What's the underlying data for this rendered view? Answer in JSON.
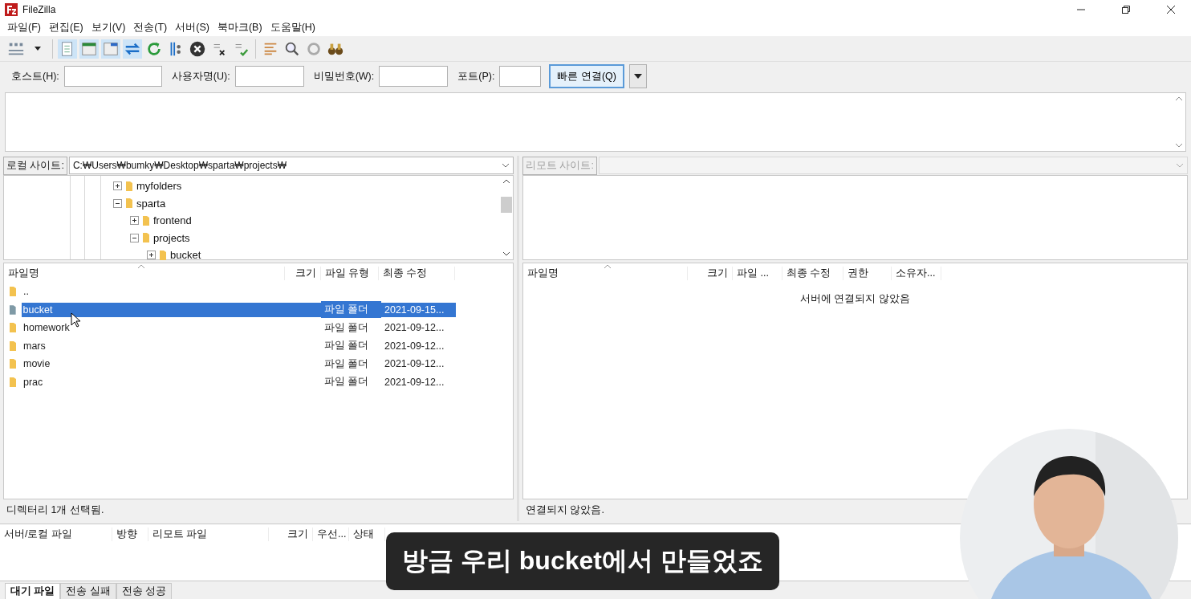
{
  "window": {
    "title": "FileZilla"
  },
  "menu": [
    "파일(F)",
    "편집(E)",
    "보기(V)",
    "전송(T)",
    "서버(S)",
    "북마크(B)",
    "도움말(H)"
  ],
  "quickconnect": {
    "fields": [
      {
        "label": "호스트(H):",
        "kind": "wide"
      },
      {
        "label": "사용자명(U):",
        "kind": "medium"
      },
      {
        "label": "비밀번호(W):",
        "kind": "medium"
      },
      {
        "label": "포트(P):",
        "kind": "narrow"
      }
    ],
    "button": "빠른 연결(Q)"
  },
  "local_site": {
    "label": "로컬 사이트:",
    "path": "C:₩Users₩bumky₩Desktop₩sparta₩projects₩"
  },
  "remote_site": {
    "label": "리모트 사이트:",
    "disabled": true
  },
  "local_tree": [
    {
      "name": "myfolders",
      "expanded": false
    },
    {
      "name": "sparta",
      "expanded": true,
      "children": [
        {
          "name": "frontend",
          "expanded": false
        },
        {
          "name": "projects",
          "expanded": true,
          "children": [
            {
              "name": "bucket",
              "expanded": false
            }
          ]
        }
      ]
    }
  ],
  "local_files": {
    "columns": [
      "파일명",
      "크기",
      "파일 유형",
      "최종 수정"
    ],
    "rows": [
      {
        "name": "..",
        "type": "",
        "modified": "",
        "selected": false
      },
      {
        "name": "bucket",
        "type": "파일 폴더",
        "modified": "2021-09-15...",
        "selected": true
      },
      {
        "name": "homework",
        "type": "파일 폴더",
        "modified": "2021-09-12...",
        "selected": false
      },
      {
        "name": "mars",
        "type": "파일 폴더",
        "modified": "2021-09-12...",
        "selected": false
      },
      {
        "name": "movie",
        "type": "파일 폴더",
        "modified": "2021-09-12...",
        "selected": false
      },
      {
        "name": "prac",
        "type": "파일 폴더",
        "modified": "2021-09-12...",
        "selected": false
      }
    ]
  },
  "remote_files": {
    "columns": [
      "파일명",
      "크기",
      "파일 ...",
      "최종 수정",
      "권한",
      "소유자..."
    ],
    "message": "서버에 연결되지 않았음"
  },
  "local_status": "디렉터리 1개 선택됨.",
  "remote_status": "연결되지 않았음.",
  "queue": {
    "columns": [
      "서버/로컬 파일",
      "방향",
      "리모트 파일",
      "크기",
      "우선...",
      "상태"
    ]
  },
  "queue_tabs": [
    {
      "label": "대기 파일",
      "selected": true
    },
    {
      "label": "전송 실패",
      "selected": false
    },
    {
      "label": "전송 성공",
      "selected": false
    }
  ],
  "subtitle": "방금 우리 bucket에서 만들었죠"
}
